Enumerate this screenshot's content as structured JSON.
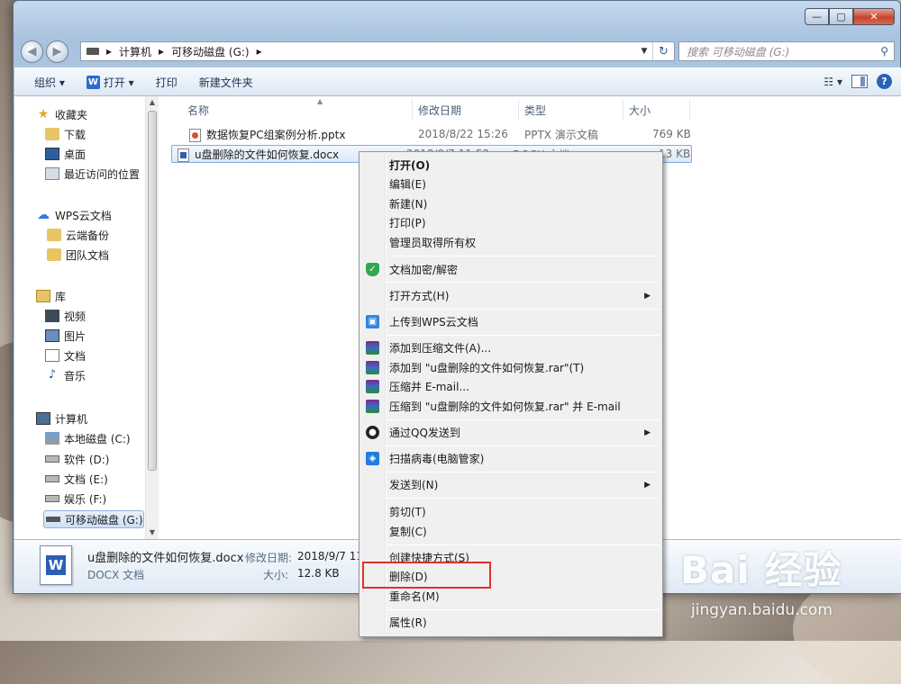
{
  "window": {
    "caption_buttons": [
      "—",
      "▢",
      "✕"
    ]
  },
  "address": {
    "segments": [
      "▸",
      "计算机",
      "▸",
      "可移动磁盘 (G:)",
      "▸"
    ],
    "search_placeholder": "搜索 可移动磁盘 (G:)"
  },
  "toolbar": {
    "organize": "组织 ▾",
    "open": "打开 ▾",
    "print": "打印",
    "new_folder": "新建文件夹"
  },
  "sidebar": {
    "favorites": "收藏夹",
    "downloads": "下载",
    "desktop": "桌面",
    "recent": "最近访问的位置",
    "wps_cloud": "WPS云文档",
    "cloud_backup": "云端备份",
    "team_docs": "团队文档",
    "libraries": "库",
    "videos": "视频",
    "pictures": "图片",
    "documents": "文档",
    "music": "音乐",
    "computer": "计算机",
    "drive_c": "本地磁盘 (C:)",
    "drive_d": "软件 (D:)",
    "drive_e": "文档 (E:)",
    "drive_f": "娱乐 (F:)",
    "drive_g": "可移动磁盘 (G:)"
  },
  "columns": {
    "name": "名称",
    "date": "修改日期",
    "type": "类型",
    "size": "大小"
  },
  "files": [
    {
      "name": "数据恢复PC组案例分析.pptx",
      "date": "2018/8/22 15:26",
      "type": "PPTX 演示文稿",
      "size": "769 KB"
    },
    {
      "name": "u盘删除的文件如何恢复.docx",
      "date": "2018/9/7 11:52",
      "type": "DOCX 文档",
      "size": "13 KB"
    }
  ],
  "details": {
    "filename": "u盘删除的文件如何恢复.docx",
    "modified_label": "修改日期:",
    "modified_value": "2018/9/7 11:5",
    "type": "DOCX 文档",
    "size_label": "大小:",
    "size_value": "12.8 KB"
  },
  "context_menu": {
    "open": "打开(O)",
    "edit": "编辑(E)",
    "new": "新建(N)",
    "print": "打印(P)",
    "take_ownership": "管理员取得所有权",
    "encrypt": "文档加密/解密",
    "open_with": "打开方式(H)",
    "upload_wps": "上传到WPS云文档",
    "add_archive": "添加到压缩文件(A)...",
    "add_to_rar": "添加到 \"u盘删除的文件如何恢复.rar\"(T)",
    "compress_email": "压缩并 E-mail...",
    "compress_rar_email": "压缩到 \"u盘删除的文件如何恢复.rar\" 并 E-mail",
    "send_qq": "通过QQ发送到",
    "scan_virus": "扫描病毒(电脑管家)",
    "send_to": "发送到(N)",
    "cut": "剪切(T)",
    "copy": "复制(C)",
    "create_shortcut": "创建快捷方式(S)",
    "delete": "删除(D)",
    "rename": "重命名(M)",
    "properties": "属性(R)"
  },
  "watermark": {
    "logo": "Bai 经验",
    "url": "jingyan.baidu.com"
  },
  "colors": {
    "highlight_box": "#e0312d",
    "selection": "#cde0f5"
  }
}
